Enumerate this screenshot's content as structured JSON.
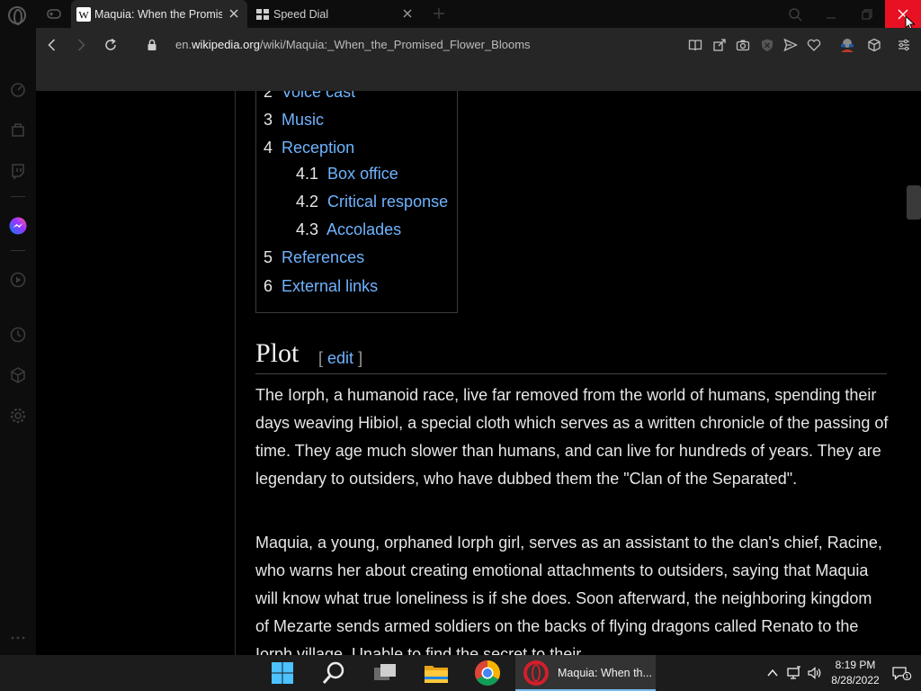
{
  "browser": {
    "tabs": [
      {
        "title": "Maquia: When the Promised Flower Blooms",
        "favicon": "wikipedia-icon",
        "active": true
      },
      {
        "title": "Speed Dial",
        "favicon": "speed-dial-icon",
        "active": false
      }
    ],
    "url_prefix": "en.",
    "url_domain": "wikipedia.org",
    "url_path": "/wiki/Maquia:_When_the_Promised_Flower_Blooms"
  },
  "toc": [
    {
      "num": "2",
      "label": "Voice cast",
      "level": 1
    },
    {
      "num": "3",
      "label": "Music",
      "level": 1
    },
    {
      "num": "4",
      "label": "Reception",
      "level": 1
    },
    {
      "num": "4.1",
      "label": "Box office",
      "level": 2
    },
    {
      "num": "4.2",
      "label": "Critical response",
      "level": 2
    },
    {
      "num": "4.3",
      "label": "Accolades",
      "level": 2
    },
    {
      "num": "5",
      "label": "References",
      "level": 1
    },
    {
      "num": "6",
      "label": "External links",
      "level": 1
    }
  ],
  "section": {
    "heading": "Plot",
    "edit_open": "[",
    "edit_label": "edit",
    "edit_close": "]"
  },
  "paragraphs": [
    "The Iorph, a humanoid race, live far removed from the world of humans, spending their days weaving Hibiol, a special cloth which serves as a written chronicle of the passing of time. They age much slower than humans, and can live for hundreds of years. They are legendary to outsiders, who have dubbed them the \"Clan of the Separated\".",
    "Maquia, a young, orphaned Iorph girl, serves as an assistant to the clan's chief, Racine, who warns her about creating emotional attachments to outsiders, saying that Maquia will know what true loneliness is if she does. Soon afterward, the neighboring kingdom of Mezarte sends armed soldiers on the backs of flying dragons called Renato to the Iorph village. Unable to find the secret to their"
  ],
  "taskbar": {
    "active_app_label": "Maquia: When th...",
    "time": "8:19 PM",
    "date": "8/28/2022",
    "notification_count": "1"
  },
  "colors": {
    "link": "#6fb3ff",
    "close_hover": "#e81123",
    "opera_red": "#d21f2b"
  }
}
